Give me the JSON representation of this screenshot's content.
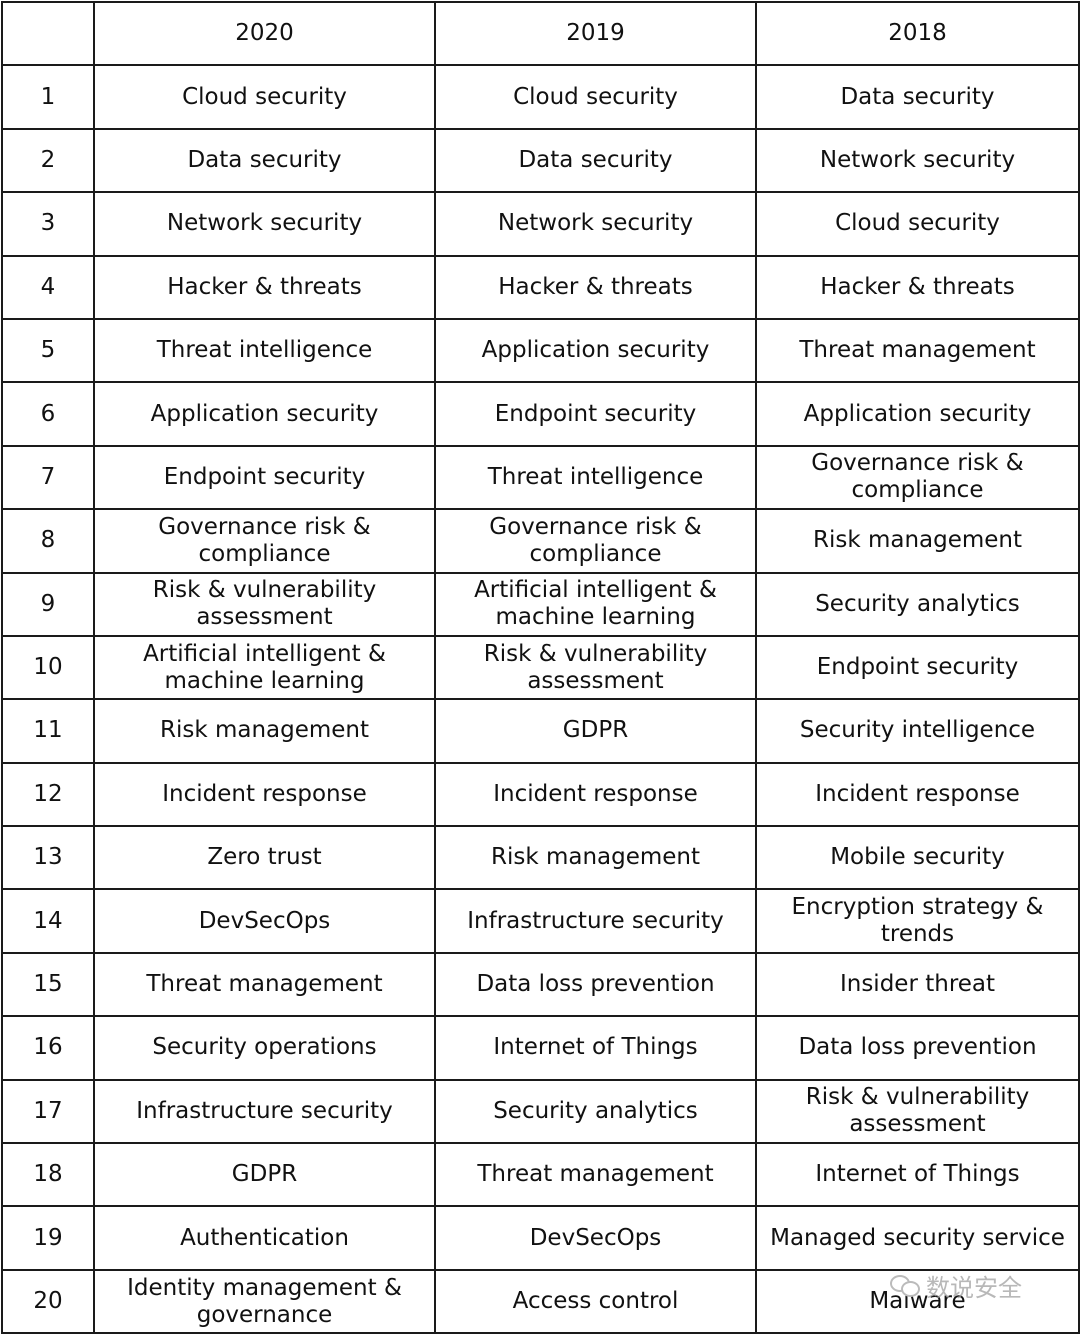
{
  "table": {
    "headers": [
      "",
      "2020",
      "2019",
      "2018"
    ],
    "rows": [
      {
        "rank": "1",
        "y2020": "Cloud security",
        "y2019": "Cloud security",
        "y2018": "Data security"
      },
      {
        "rank": "2",
        "y2020": "Data security",
        "y2019": "Data security",
        "y2018": "Network security"
      },
      {
        "rank": "3",
        "y2020": "Network security",
        "y2019": "Network security",
        "y2018": "Cloud security"
      },
      {
        "rank": "4",
        "y2020": "Hacker & threats",
        "y2019": "Hacker & threats",
        "y2018": "Hacker & threats"
      },
      {
        "rank": "5",
        "y2020": "Threat intelligence",
        "y2019": "Application security",
        "y2018": "Threat management"
      },
      {
        "rank": "6",
        "y2020": "Application security",
        "y2019": "Endpoint security",
        "y2018": "Application security"
      },
      {
        "rank": "7",
        "y2020": "Endpoint security",
        "y2019": "Threat intelligence",
        "y2018": "Governance risk & compliance"
      },
      {
        "rank": "8",
        "y2020": "Governance risk & compliance",
        "y2019": "Governance risk & compliance",
        "y2018": "Risk management"
      },
      {
        "rank": "9",
        "y2020": "Risk & vulnerability assessment",
        "y2019": "Artificial intelligent & machine learning",
        "y2018": "Security analytics"
      },
      {
        "rank": "10",
        "y2020": "Artificial intelligent & machine learning",
        "y2019": "Risk & vulnerability assessment",
        "y2018": "Endpoint security"
      },
      {
        "rank": "11",
        "y2020": "Risk management",
        "y2019": "GDPR",
        "y2018": "Security intelligence"
      },
      {
        "rank": "12",
        "y2020": "Incident response",
        "y2019": "Incident response",
        "y2018": "Incident response"
      },
      {
        "rank": "13",
        "y2020": "Zero trust",
        "y2019": "Risk management",
        "y2018": "Mobile security"
      },
      {
        "rank": "14",
        "y2020": "DevSecOps",
        "y2019": "Infrastructure security",
        "y2018": "Encryption strategy & trends"
      },
      {
        "rank": "15",
        "y2020": "Threat management",
        "y2019": "Data loss prevention",
        "y2018": "Insider threat"
      },
      {
        "rank": "16",
        "y2020": "Security operations",
        "y2019": "Internet of Things",
        "y2018": "Data loss prevention"
      },
      {
        "rank": "17",
        "y2020": "Infrastructure security",
        "y2019": "Security analytics",
        "y2018": "Risk & vulnerability assessment"
      },
      {
        "rank": "18",
        "y2020": "GDPR",
        "y2019": "Threat management",
        "y2018": "Internet of Things"
      },
      {
        "rank": "19",
        "y2020": "Authentication",
        "y2019": "DevSecOps",
        "y2018": "Managed security service"
      },
      {
        "rank": "20",
        "y2020": "Identity management & governance",
        "y2019": "Access control",
        "y2018": "Malware"
      }
    ]
  },
  "watermark": {
    "text": "数说安全",
    "icon": "wechat-icon"
  }
}
